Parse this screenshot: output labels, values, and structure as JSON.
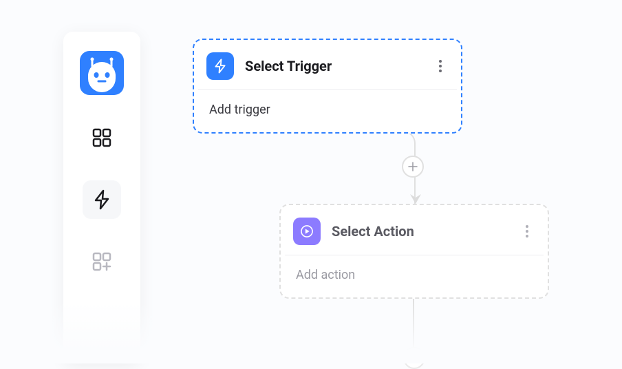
{
  "colors": {
    "primary_blue": "#2f80ff",
    "action_purple": "#8c7bff"
  },
  "sidebar": {
    "app_name": "robot-app",
    "items": [
      {
        "name": "apps",
        "label": "Apps"
      },
      {
        "name": "automations",
        "label": "Automations"
      },
      {
        "name": "integrations",
        "label": "Integrations"
      }
    ],
    "selected_index": 1
  },
  "nodes": {
    "trigger": {
      "title": "Select Trigger",
      "body": "Add  trigger",
      "icon_name": "bolt"
    },
    "action": {
      "title": "Select Action",
      "body": "Add  action",
      "icon_name": "play-circle"
    }
  },
  "buttons": {
    "add_step": "+"
  }
}
